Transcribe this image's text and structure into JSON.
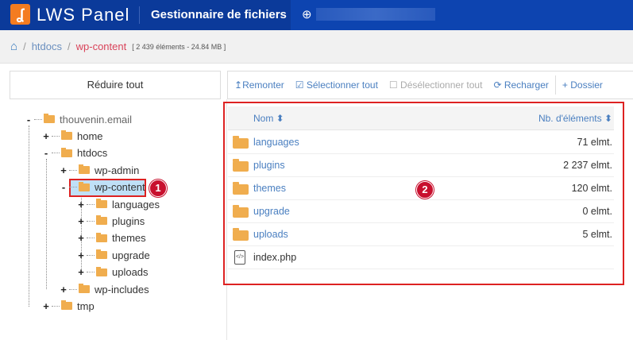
{
  "header": {
    "logo_text": "LWS Panel",
    "title": "Gestionnaire de fichiers",
    "globe_icon": "globe-icon"
  },
  "breadcrumb": {
    "items": [
      "htdocs",
      "wp-content"
    ],
    "info": "[ 2 439 éléments - 24.84 MB ]"
  },
  "tree": {
    "collapse_label": "Réduire tout",
    "nodes": [
      {
        "label": "thouvenin.email",
        "toggle": "-"
      },
      {
        "label": "home",
        "toggle": "+"
      },
      {
        "label": "htdocs",
        "toggle": "-"
      },
      {
        "label": "wp-admin",
        "toggle": "+"
      },
      {
        "label": "wp-content",
        "toggle": "-"
      },
      {
        "label": "languages",
        "toggle": "+"
      },
      {
        "label": "plugins",
        "toggle": "+"
      },
      {
        "label": "themes",
        "toggle": "+"
      },
      {
        "label": "upgrade",
        "toggle": "+"
      },
      {
        "label": "uploads",
        "toggle": "+"
      },
      {
        "label": "wp-includes",
        "toggle": "+"
      },
      {
        "label": "tmp",
        "toggle": "+"
      }
    ]
  },
  "toolbar": {
    "up": "Remonter",
    "select_all": "Sélectionner tout",
    "deselect_all": "Désélectionner tout",
    "reload": "Recharger",
    "new_folder": "Dossier"
  },
  "table": {
    "col_name": "Nom",
    "col_count": "Nb. d'éléments",
    "rows": [
      {
        "name": "languages",
        "count": "71 elmt.",
        "type": "folder"
      },
      {
        "name": "plugins",
        "count": "2 237 elmt.",
        "type": "folder"
      },
      {
        "name": "themes",
        "count": "120 elmt.",
        "type": "folder"
      },
      {
        "name": "upgrade",
        "count": "0 elmt.",
        "type": "folder"
      },
      {
        "name": "uploads",
        "count": "5 elmt.",
        "type": "folder"
      },
      {
        "name": "index.php",
        "count": "",
        "type": "file"
      }
    ]
  },
  "annotations": {
    "a1": "1",
    "a2": "2"
  },
  "colors": {
    "header": "#0b3a9a",
    "accent": "#4a7fc0",
    "highlight": "#d22222",
    "folder": "#f0ad4e"
  }
}
